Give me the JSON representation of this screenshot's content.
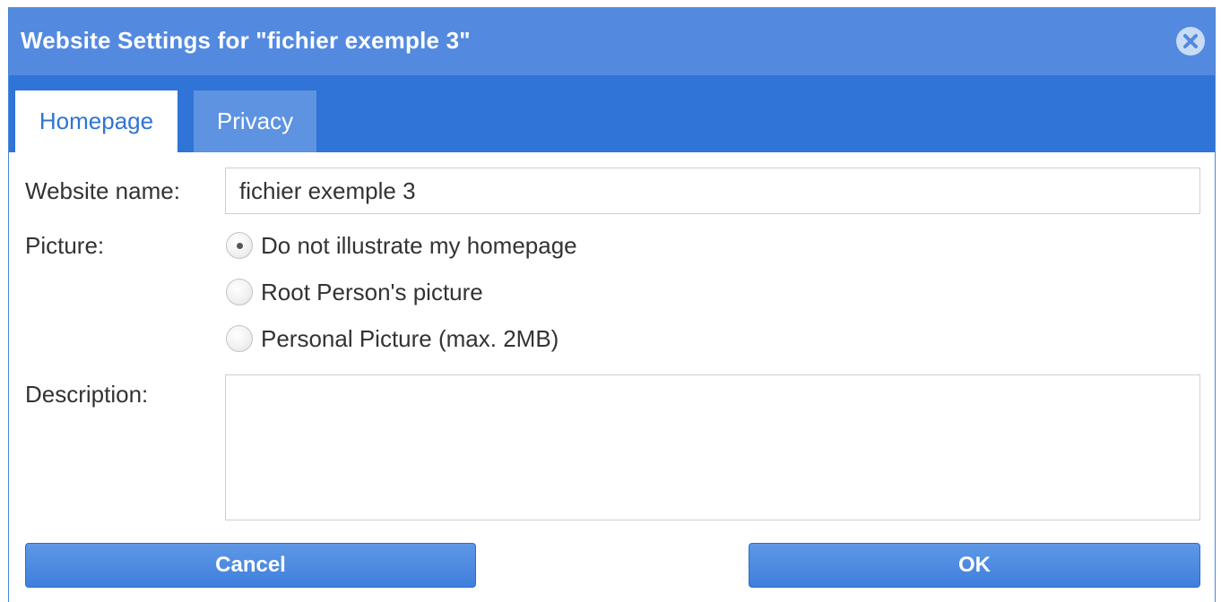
{
  "dialog": {
    "title": "Website Settings for \"fichier exemple 3\"",
    "close_icon": "close-circle-icon"
  },
  "tabs": [
    {
      "label": "Homepage",
      "active": true
    },
    {
      "label": "Privacy",
      "active": false
    }
  ],
  "form": {
    "website_name_label": "Website name:",
    "website_name_value": "fichier exemple 3",
    "picture_label": "Picture:",
    "picture_options": [
      {
        "label": "Do not illustrate my homepage",
        "selected": true
      },
      {
        "label": "Root Person's picture",
        "selected": false
      },
      {
        "label": "Personal Picture (max. 2MB)",
        "selected": false
      }
    ],
    "description_label": "Description:",
    "description_value": ""
  },
  "buttons": {
    "cancel_label": "Cancel",
    "ok_label": "OK"
  },
  "colors": {
    "titlebar": "#538ae0",
    "tabbar": "#2f74d6",
    "tab_inactive": "#5d93e0",
    "button": "#4a87de"
  }
}
